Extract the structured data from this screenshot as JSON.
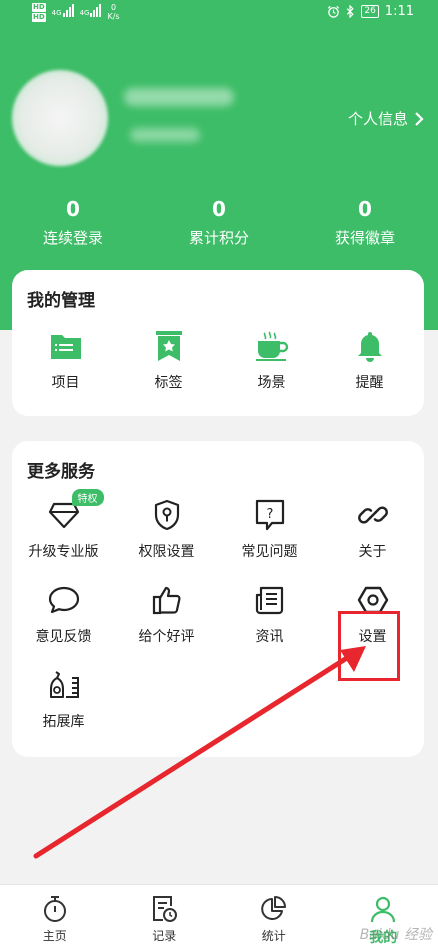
{
  "status_bar": {
    "hd_top": "HD",
    "hd_bottom": "HD",
    "net1": "4G",
    "net2": "4G",
    "speed_value": "0",
    "speed_unit": "K/s",
    "battery": "26",
    "time": "1:11"
  },
  "profile": {
    "link_label": "个人信息",
    "stats": [
      {
        "value": "0",
        "label": "连续登录"
      },
      {
        "value": "0",
        "label": "累计积分"
      },
      {
        "value": "0",
        "label": "获得徽章"
      }
    ]
  },
  "management": {
    "title": "我的管理",
    "items": [
      {
        "label": "项目",
        "icon": "folder-icon"
      },
      {
        "label": "标签",
        "icon": "bookmark-icon"
      },
      {
        "label": "场景",
        "icon": "coffee-cup-icon"
      },
      {
        "label": "提醒",
        "icon": "bell-icon"
      }
    ]
  },
  "services": {
    "title": "更多服务",
    "badge": "特权",
    "items": [
      {
        "label": "升级专业版",
        "icon": "diamond-icon"
      },
      {
        "label": "权限设置",
        "icon": "shield-key-icon"
      },
      {
        "label": "常见问题",
        "icon": "question-icon"
      },
      {
        "label": "关于",
        "icon": "link-icon"
      },
      {
        "label": "意见反馈",
        "icon": "chat-bubble-icon"
      },
      {
        "label": "给个好评",
        "icon": "thumbs-up-icon"
      },
      {
        "label": "资讯",
        "icon": "news-icon"
      },
      {
        "label": "设置",
        "icon": "hexagon-nut-icon"
      },
      {
        "label": "拓展库",
        "icon": "library-icon"
      }
    ]
  },
  "tabbar": {
    "items": [
      {
        "label": "主页",
        "icon": "stopwatch-icon"
      },
      {
        "label": "记录",
        "icon": "record-icon"
      },
      {
        "label": "统计",
        "icon": "pie-chart-icon"
      },
      {
        "label": "我的",
        "icon": "user-icon",
        "active": true
      }
    ]
  },
  "watermark": "Baidu 经验",
  "colors": {
    "accent": "#3dbd67",
    "annotation": "#e8262d"
  }
}
